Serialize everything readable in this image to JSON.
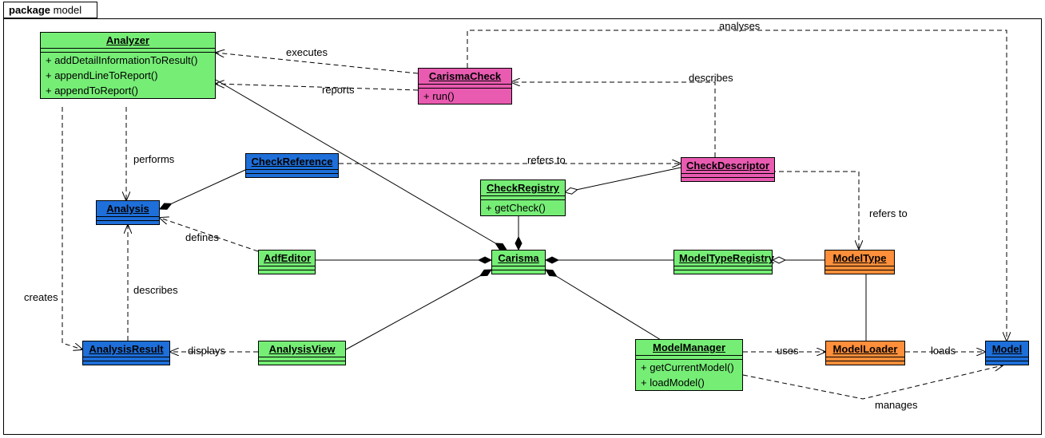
{
  "package": {
    "keyword": "package",
    "name": "model"
  },
  "labels": {
    "executes": "executes",
    "reports": "reports",
    "performs": "performs",
    "creates": "creates",
    "describes_result": "describes",
    "describes_check": "describes",
    "defines": "defines",
    "displays": "displays",
    "refers_to_check": "refers to",
    "refers_to_checkdesc": "refers to",
    "analyses": "analyses",
    "uses": "uses",
    "loads": "loads",
    "manages": "manages"
  },
  "classes": {
    "Analyzer": {
      "name": "Analyzer",
      "methods": [
        "+ addDetailInformationToResult()",
        "+ appendLineToReport()",
        "+ appendToReport()"
      ]
    },
    "CarismaCheck": {
      "name": "CarismaCheck",
      "methods": [
        "+ run()"
      ]
    },
    "CheckReference": {
      "name": "CheckReference",
      "methods": []
    },
    "CheckDescriptor": {
      "name": "CheckDescriptor",
      "methods": []
    },
    "CheckRegistry": {
      "name": "CheckRegistry",
      "methods": [
        "+ getCheck()"
      ]
    },
    "Analysis": {
      "name": "Analysis",
      "methods": []
    },
    "AdfEditor": {
      "name": "AdfEditor",
      "methods": []
    },
    "Carisma": {
      "name": "Carisma",
      "methods": []
    },
    "ModelTypeRegistry": {
      "name": "ModelTypeRegistry",
      "methods": []
    },
    "ModelType": {
      "name": "ModelType",
      "methods": []
    },
    "AnalysisResult": {
      "name": "AnalysisResult",
      "methods": []
    },
    "AnalysisView": {
      "name": "AnalysisView",
      "methods": []
    },
    "ModelManager": {
      "name": "ModelManager",
      "methods": [
        "+ getCurrentModel()",
        "+ loadModel()"
      ]
    },
    "ModelLoader": {
      "name": "ModelLoader",
      "methods": []
    },
    "Model": {
      "name": "Model",
      "methods": []
    }
  }
}
